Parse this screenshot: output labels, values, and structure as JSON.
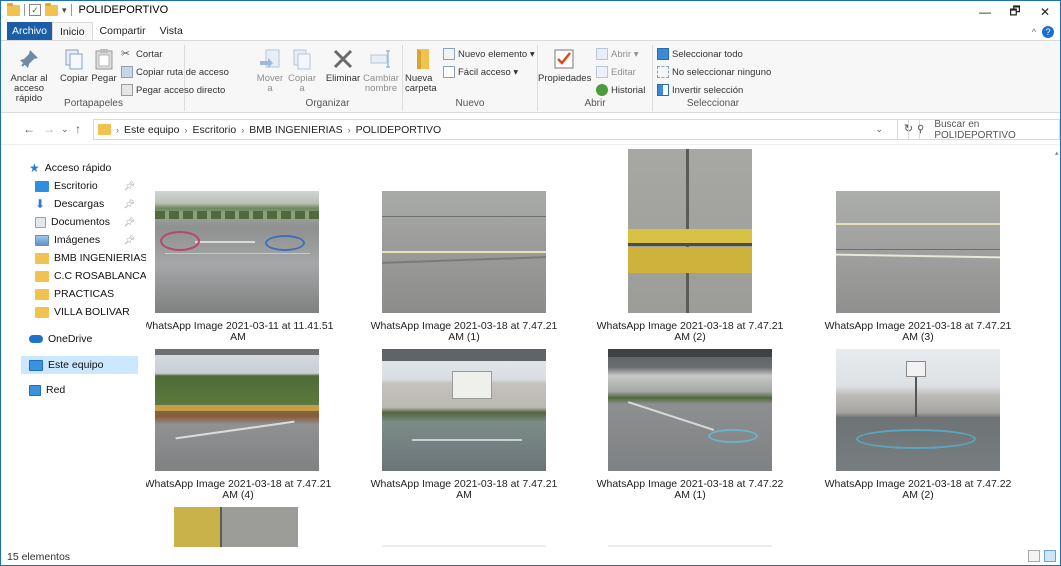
{
  "window": {
    "title": "POLIDEPORTIVO",
    "controls": {
      "minimize": "—",
      "maximize": "🗗",
      "close": "✕"
    }
  },
  "tabs": {
    "file": "Archivo",
    "home": "Inicio",
    "share": "Compartir",
    "view": "Vista"
  },
  "ribbon": {
    "portapapeles": {
      "label": "Portapapeles",
      "pin": "Anclar al acceso rápido",
      "copy": "Copiar",
      "paste": "Pegar",
      "cut": "Cortar",
      "copy_path": "Copiar ruta de acceso",
      "paste_shortcut": "Pegar acceso directo"
    },
    "organizar": {
      "label": "Organizar",
      "move": "Mover a",
      "copy_to": "Copiar a",
      "delete": "Eliminar",
      "rename": "Cambiar nombre"
    },
    "nuevo": {
      "label": "Nuevo",
      "new_folder": "Nueva carpeta",
      "new_item": "Nuevo elemento ▾",
      "easy_access": "Fácil acceso ▾"
    },
    "abrir": {
      "label": "Abrir",
      "properties": "Propiedades",
      "open": "Abrir ▾",
      "edit": "Editar",
      "history": "Historial"
    },
    "seleccionar": {
      "label": "Seleccionar",
      "select_all": "Seleccionar todo",
      "select_none": "No seleccionar ninguno",
      "invert": "Invertir selección"
    }
  },
  "address": {
    "crumbs": [
      "Este equipo",
      "Escritorio",
      "BMB INGENIERIAS",
      "POLIDEPORTIVO"
    ],
    "search_placeholder": "Buscar en POLIDEPORTIVO"
  },
  "nav": {
    "quick_access": "Acceso rápido",
    "items": [
      "Escritorio",
      "Descargas",
      "Documentos",
      "Imágenes",
      "BMB INGENIERIAS",
      "C.C ROSABLANCA",
      "PRACTICAS",
      "VILLA BOLIVAR"
    ],
    "onedrive": "OneDrive",
    "this_pc": "Este equipo",
    "network": "Red"
  },
  "files": [
    {
      "line1": "WhatsApp Image 2021-03-11 at 11.41.51",
      "line2": "AM"
    },
    {
      "line1": "WhatsApp Image 2021-03-18 at 7.47.21",
      "line2": "AM (1)"
    },
    {
      "line1": "WhatsApp Image 2021-03-18 at 7.47.21",
      "line2": "AM (2)"
    },
    {
      "line1": "WhatsApp Image 2021-03-18 at 7.47.21",
      "line2": "AM (3)"
    },
    {
      "line1": "WhatsApp Image 2021-03-18 at 7.47.21",
      "line2": "AM (4)"
    },
    {
      "line1": "WhatsApp Image 2021-03-18 at 7.47.21",
      "line2": "AM"
    },
    {
      "line1": "WhatsApp Image 2021-03-18 at 7.47.22",
      "line2": "AM (1)"
    },
    {
      "line1": "WhatsApp Image 2021-03-18 at 7.47.22",
      "line2": "AM (2)"
    }
  ],
  "status": {
    "count": "15 elementos"
  }
}
